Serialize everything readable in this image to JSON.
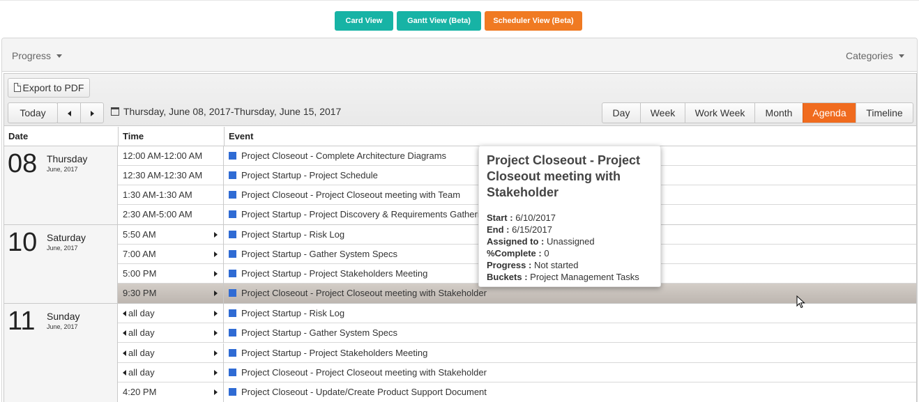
{
  "views": {
    "card": "Card View",
    "gantt": "Gantt View (Beta)",
    "scheduler": "Scheduler View (Beta)"
  },
  "filters": {
    "progress": "Progress",
    "categories": "Categories"
  },
  "toolbar": {
    "export_label": "Export to PDF",
    "today_label": "Today",
    "date_range": "Thursday, June 08, 2017-Thursday, June 15, 2017",
    "view_tabs": [
      "Day",
      "Week",
      "Work Week",
      "Month",
      "Agenda",
      "Timeline"
    ],
    "active_view": "Agenda"
  },
  "columns": {
    "date": "Date",
    "time": "Time",
    "event": "Event"
  },
  "groups": [
    {
      "day": "08",
      "weekday": "Thursday",
      "month_year": "June, 2017",
      "events": [
        {
          "time": "12:00 AM-12:00 AM",
          "title": "Project Closeout - Complete Architecture Diagrams"
        },
        {
          "time": "12:30 AM-12:30 AM",
          "title": "Project Startup - Project Schedule"
        },
        {
          "time": "1:30 AM-1:30 AM",
          "title": "Project Closeout - Project Closeout meeting with Team"
        },
        {
          "time": "2:30 AM-5:00 AM",
          "title": "Project Startup - Project Discovery & Requirements Gathering"
        }
      ]
    },
    {
      "day": "10",
      "weekday": "Saturday",
      "month_year": "June, 2017",
      "events": [
        {
          "time": "5:50 AM",
          "title": "Project Startup - Risk Log"
        },
        {
          "time": "7:00 AM",
          "title": "Project Startup - Gather System Specs"
        },
        {
          "time": "5:00 PM",
          "title": "Project Startup - Project Stakeholders Meeting"
        },
        {
          "time": "9:30 PM",
          "title": "Project Closeout - Project Closeout meeting with Stakeholder"
        }
      ]
    },
    {
      "day": "11",
      "weekday": "Sunday",
      "month_year": "June, 2017",
      "events": [
        {
          "time": "all day",
          "title": "Project Startup - Risk Log"
        },
        {
          "time": "all day",
          "title": "Project Startup - Gather System Specs"
        },
        {
          "time": "all day",
          "title": "Project Startup - Project Stakeholders Meeting"
        },
        {
          "time": "all day",
          "title": "Project Closeout - Project Closeout meeting with Stakeholder"
        },
        {
          "time": "4:20 PM",
          "title": "Project Closeout - Update/Create Product Support Document"
        }
      ]
    }
  ],
  "tooltip": {
    "title": "Project Closeout - Project Closeout meeting with Stakeholder",
    "start_label": "Start :",
    "start": "6/10/2017",
    "end_label": "End :",
    "end": "6/15/2017",
    "assigned_label": "Assigned to :",
    "assigned": "Unassigned",
    "complete_label": "%Complete :",
    "complete": "0",
    "progress_label": "Progress :",
    "progress": "Not started",
    "buckets_label": "Buckets :",
    "buckets": "Project Management Tasks"
  },
  "colors": {
    "teal": "#17b3a5",
    "orange": "#f07a22",
    "event": "#2f6bd4",
    "active_tab": "#f06b1e"
  }
}
